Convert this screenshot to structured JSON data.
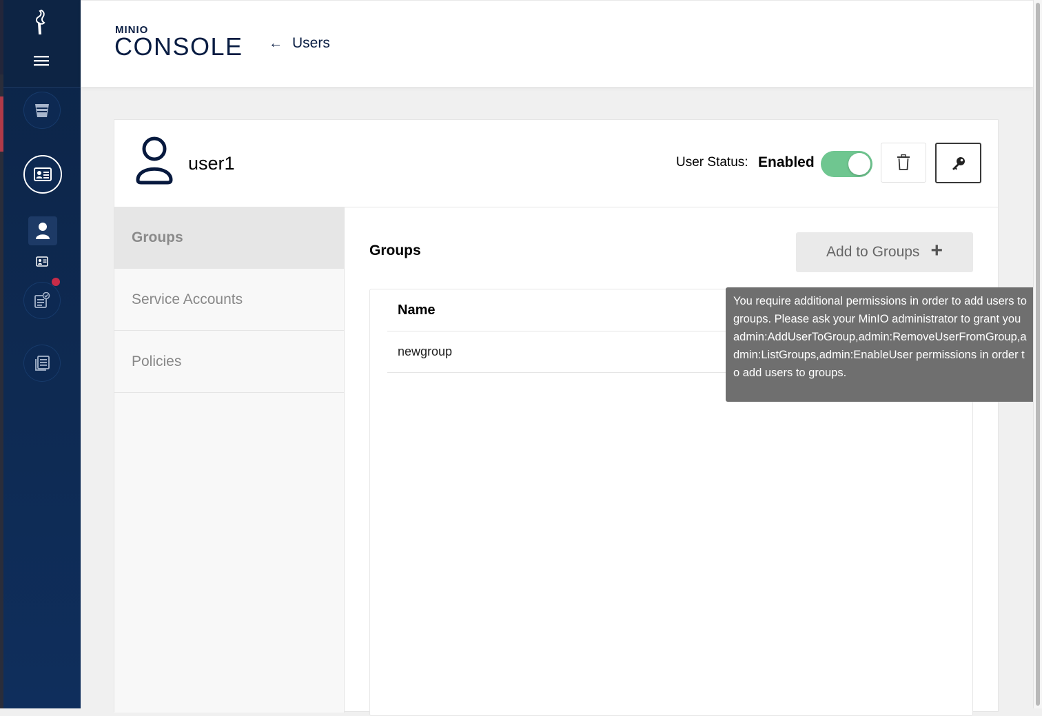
{
  "brand": {
    "small": "MINIO",
    "large": "CONSOLE"
  },
  "header": {
    "back_label": "Users"
  },
  "user": {
    "name": "user1",
    "status_label": "User Status:",
    "status_value": "Enabled",
    "enabled": true
  },
  "tabs": [
    {
      "label": "Groups",
      "active": true
    },
    {
      "label": "Service Accounts",
      "active": false
    },
    {
      "label": "Policies",
      "active": false
    }
  ],
  "groups": {
    "title": "Groups",
    "add_button_label": "Add to Groups",
    "columns": [
      "Name"
    ],
    "rows": [
      {
        "name": "newgroup"
      }
    ]
  },
  "tooltip": {
    "text": "You require additional permissions in order to add users to groups. Please ask your MinIO administrator to grant you admin:AddUserToGroup,admin:RemoveUserFromGroup,admin:ListGroups,admin:EnableUser permissions in order to add users to groups."
  },
  "colors": {
    "sidebar": "#0e2a52",
    "toggle_on": "#6fc690",
    "notification": "#c72c48",
    "tooltip_bg": "#6f6f6f"
  },
  "icons": {
    "logo": "minio-bird-icon",
    "menu": "hamburger-menu-icon",
    "buckets": "bucket-icon",
    "identity": "id-card-icon",
    "users": "user-icon",
    "monitoring": "checklist-icon",
    "logs": "document-list-icon",
    "delete": "trash-icon",
    "password": "key-icon"
  }
}
